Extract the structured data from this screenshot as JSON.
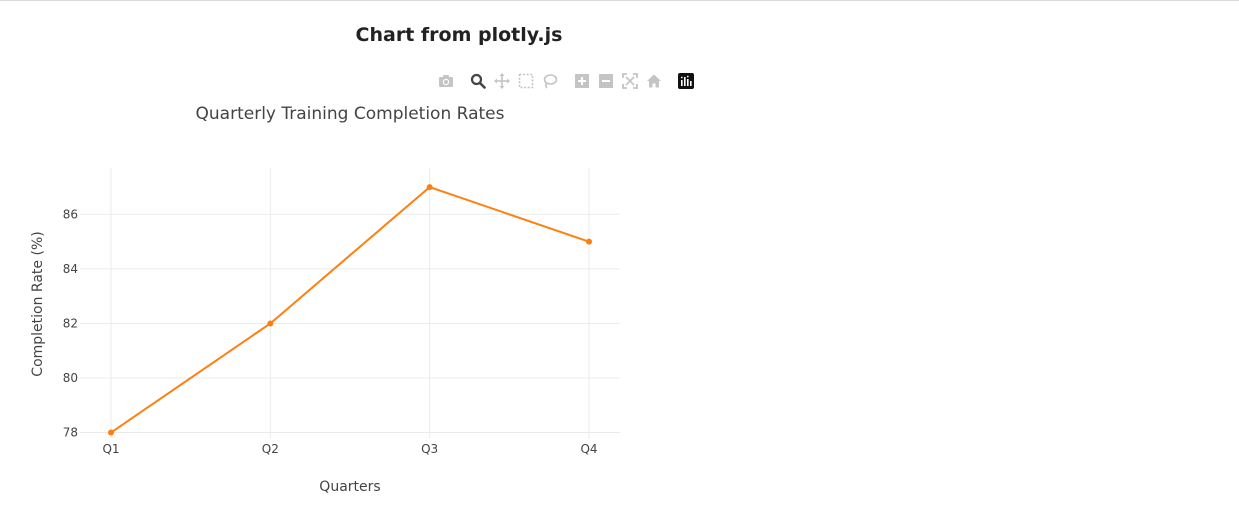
{
  "page": {
    "title": "Chart from plotly.js"
  },
  "modebar": {
    "buttons": [
      {
        "name": "camera-icon",
        "active": false
      },
      {
        "name": "zoom-icon",
        "active": true
      },
      {
        "name": "pan-icon",
        "active": false
      },
      {
        "name": "box-select-icon",
        "active": false
      },
      {
        "name": "lasso-select-icon",
        "active": false
      },
      {
        "name": "zoom-in-icon",
        "active": false
      },
      {
        "name": "zoom-out-icon",
        "active": false
      },
      {
        "name": "autoscale-icon",
        "active": false
      },
      {
        "name": "reset-axes-icon",
        "active": false
      },
      {
        "name": "plotly-logo-icon",
        "active": false
      }
    ],
    "icon_color": "#c4c4c4",
    "active_color": "#444444"
  },
  "chart_data": {
    "type": "line",
    "title": "Quarterly Training Completion Rates",
    "xlabel": "Quarters",
    "ylabel": "Completion Rate (%)",
    "categories": [
      "Q1",
      "Q2",
      "Q3",
      "Q4"
    ],
    "series": [
      {
        "values": [
          78,
          82,
          87,
          85
        ],
        "color": "#ff7f0e",
        "mode": "lines+markers"
      }
    ],
    "yticks": [
      78,
      80,
      82,
      84,
      86
    ],
    "ylim": [
      77.8,
      87.7
    ],
    "grid": true,
    "legend": "none"
  }
}
